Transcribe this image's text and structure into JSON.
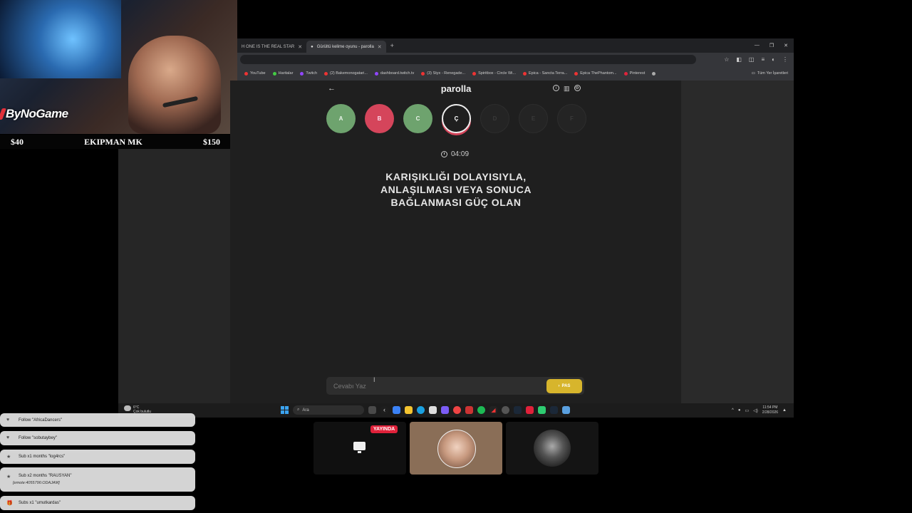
{
  "stream_overlay": {
    "logo_text": "ByNoGame",
    "goal": {
      "current": "$40",
      "label": "EKIPMAN MK",
      "target": "$150"
    }
  },
  "browser": {
    "tabs": [
      {
        "title": "H ONE IS THE REAL STAR",
        "active": false
      },
      {
        "title": "Gürültü kelime oyunu - parolla",
        "active": true
      }
    ],
    "bookmarks": [
      "YouTube",
      "Haritalar",
      "Twitch",
      "(2) Bakemonogatari...",
      "dashboard.twitch.tv",
      "(3) Styx - Renegade...",
      "Spiritbox - Circle Wi...",
      "Epica - Sancta Terra...",
      "Epica ThePhantom...",
      "Pinterest"
    ],
    "bookmarks_other": "Tüm Yer İşaretleri"
  },
  "parolla": {
    "title": "parolla",
    "letters": [
      {
        "letter": "A",
        "state": "correct"
      },
      {
        "letter": "B",
        "state": "wrong"
      },
      {
        "letter": "C",
        "state": "correct"
      },
      {
        "letter": "Ç",
        "state": "current"
      },
      {
        "letter": "D",
        "state": "pending"
      },
      {
        "letter": "E",
        "state": "pending"
      },
      {
        "letter": "F",
        "state": "pending"
      }
    ],
    "timer": "04:09",
    "question_lines": [
      "KARIŞIKLIĞI DOLAYISIYLA,",
      "ANLAŞILMASI VEYA SONUCA",
      "BAĞLANMASI GÜÇ OLAN"
    ],
    "answer_placeholder": "Cevabı Yaz",
    "pass_label": "PAS"
  },
  "taskbar": {
    "weather_temp": "6°C",
    "weather_desc": "Çok bulutlu",
    "search_placeholder": "Ara",
    "time": "11:54 PM",
    "date": "2/28/2026"
  },
  "events": [
    {
      "icon": "heart-icon",
      "text": "Follow \"AfricaDancers\"",
      "sub": ""
    },
    {
      "icon": "heart-icon",
      "text": "Follow \"sobutaybey\"",
      "sub": ""
    },
    {
      "icon": "star-icon",
      "text": "Sub x1 months \"log4rcs\"",
      "sub": ""
    },
    {
      "icon": "star-icon",
      "text": "Sub x2 months \"RAUSYAN\"",
      "sub": "[emote:4055796:ODAJAM]"
    },
    {
      "icon": "gift-icon",
      "text": "Subs x1 \"umutkardas\"",
      "sub": ""
    }
  ],
  "call": {
    "live_label": "YAYINDA"
  }
}
